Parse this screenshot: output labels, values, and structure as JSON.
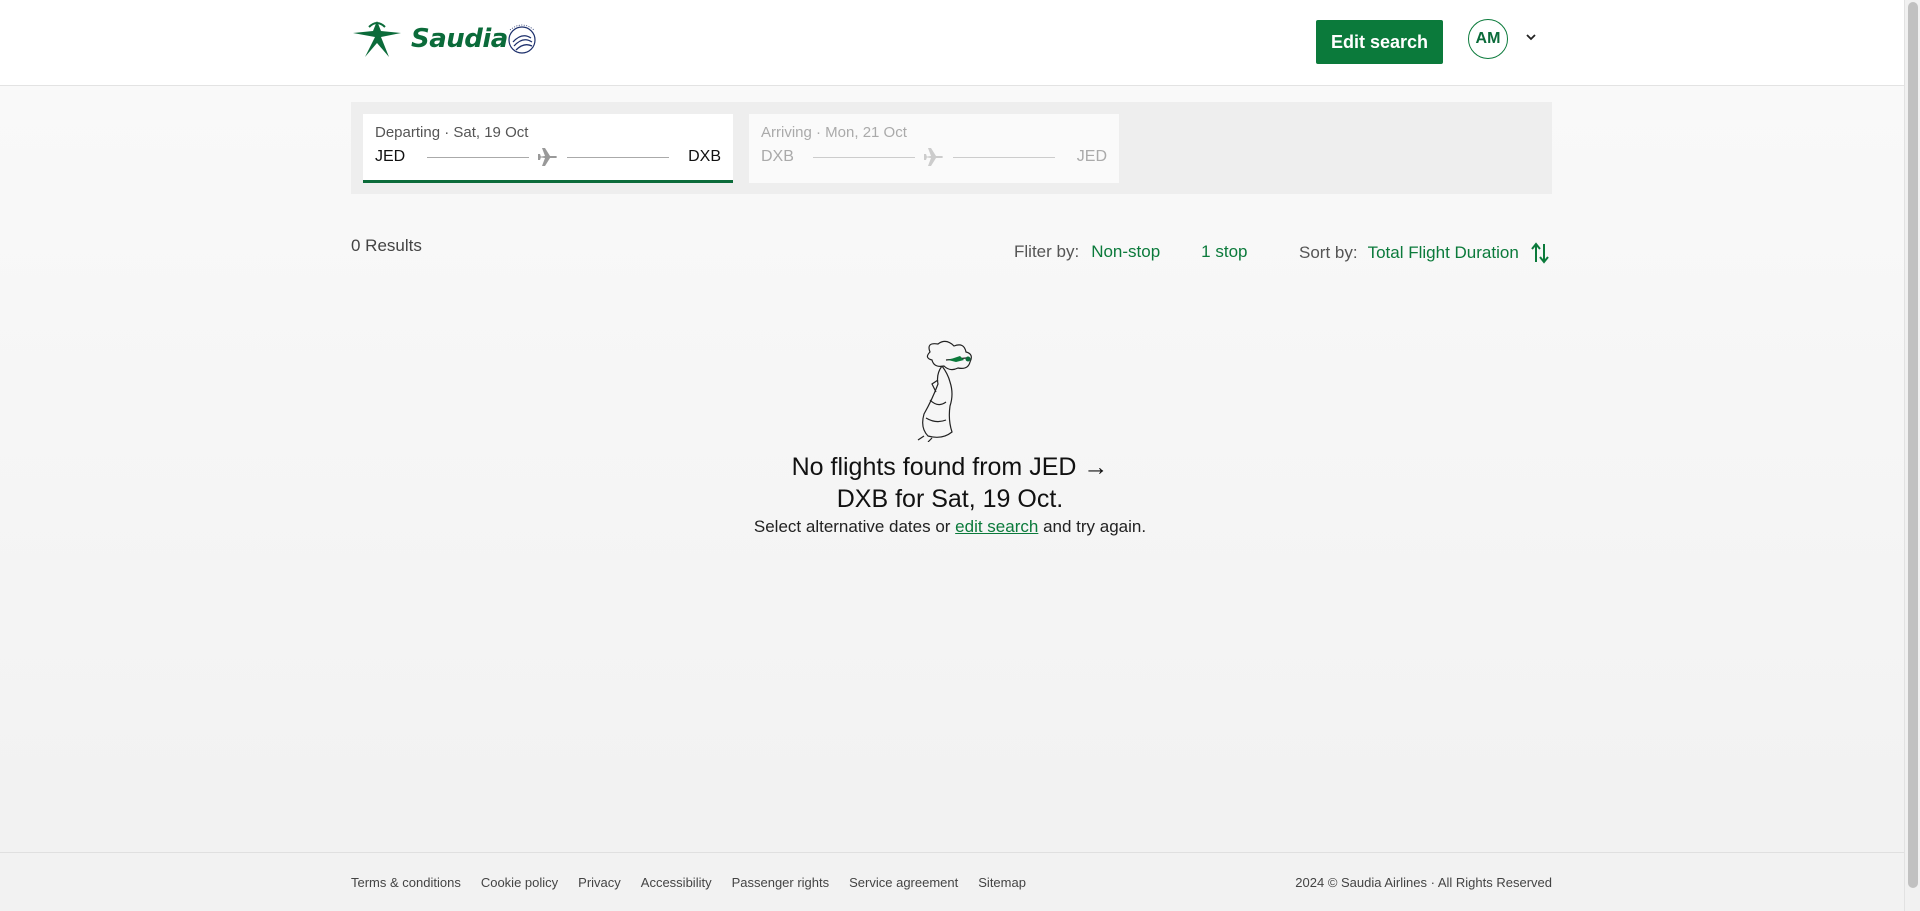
{
  "header": {
    "brand": "Saudia",
    "edit_search_label": "Edit search",
    "avatar_initials": "AM"
  },
  "trip": {
    "outbound": {
      "meta": "Departing · Sat, 19 Oct",
      "from": "JED",
      "to": "DXB",
      "active": true
    },
    "return": {
      "meta": "Arriving · Mon, 21 Oct",
      "from": "DXB",
      "to": "JED",
      "active": false
    }
  },
  "results": {
    "count_text": "0 Results",
    "filter_label": "Fliter by:",
    "filter_options": [
      "Non-stop",
      "1 stop"
    ],
    "sort_label": "Sort by:",
    "sort_value": "Total Flight Duration"
  },
  "empty_state": {
    "title_line1": "No flights found from JED →",
    "title_line2": "DXB for Sat, 19 Oct.",
    "sub_before": "Select alternative dates or ",
    "sub_link": "edit search",
    "sub_after": " and try again."
  },
  "footer": {
    "links": [
      "Terms & conditions",
      "Cookie policy",
      "Privacy",
      "Accessibility",
      "Passenger rights",
      "Service agreement",
      "Sitemap"
    ],
    "copyright": "2024 © Saudia Airlines · All Rights Reserved"
  },
  "colors": {
    "brand_green": "#0b7a3b",
    "dark_green": "#0b6b3a"
  },
  "icons": [
    "saudia-logo-icon",
    "skyteam-icon",
    "chevron-down-icon",
    "plane-icon",
    "sort-arrows-icon",
    "traveler-illustration"
  ]
}
